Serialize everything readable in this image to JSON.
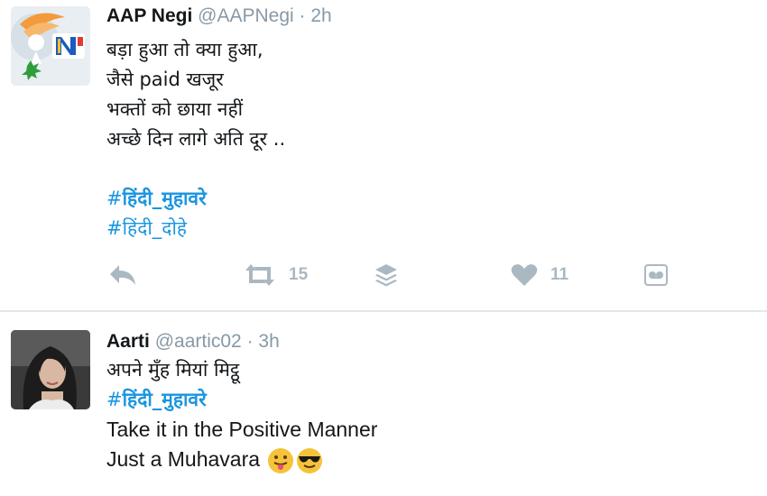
{
  "tweets": [
    {
      "name": "AAP Negi",
      "handle": "@AAPNegi",
      "separator": "·",
      "time": "2h",
      "lines": [
        "बड़ा हुआ तो क्या हुआ,",
        "जैसे paid खजूर",
        "भक्तों को छाया नहीं",
        "अच्छे दिन लागे अति दूर .."
      ],
      "hashtags": [
        {
          "hash": "#",
          "text": "हिंदी_मुहावरे"
        },
        {
          "hash": "#",
          "text": "हिंदी_दोहे"
        }
      ],
      "actions": {
        "reply_icon": "reply-icon",
        "retweet_icon": "retweet-icon",
        "retweet_count": "15",
        "buffer_icon": "buffer-layers-icon",
        "like_icon": "heart-icon",
        "like_count": "11",
        "more_icon": "analytics-icon"
      }
    },
    {
      "name": "Aarti",
      "handle": "@aartic02",
      "separator": "·",
      "time": "3h",
      "lines": [
        "अपने मुँह मियां मिट्ठू"
      ],
      "hashtags": [
        {
          "hash": "#",
          "text": "हिंदी_मुहावरे"
        }
      ],
      "lines_after": [
        "Take it in the Positive Manner",
        "Just a Muhavara"
      ],
      "emojis": [
        "tongue-out-face-emoji",
        "sunglasses-face-emoji"
      ]
    }
  ],
  "colors": {
    "link": "#1b95e0",
    "muted": "#8899a6",
    "icon": "#aab8c2",
    "divider": "#e1e8ed"
  }
}
